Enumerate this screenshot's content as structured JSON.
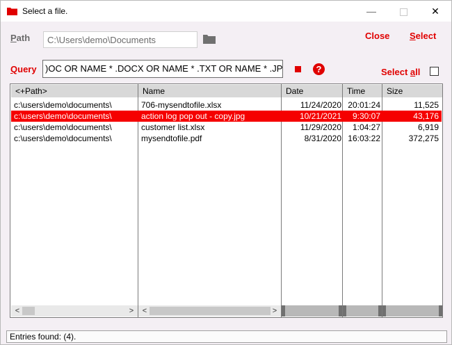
{
  "window": {
    "title": "Select a file.",
    "controls": {
      "minimize": "—",
      "close": "✕"
    }
  },
  "path": {
    "label_first": "P",
    "label_rest": "ath",
    "value": "C:\\Users\\demo\\Documents"
  },
  "actions": {
    "close": "Close",
    "select_first": "S",
    "select_rest": "elect"
  },
  "query": {
    "label_first": "Q",
    "label_rest": "uery",
    "value": ")OC OR NAME * .DOCX OR NAME * .TXT OR NAME * .JPG",
    "help": "?",
    "select_all_pre": "Select ",
    "select_all_u": "a",
    "select_all_post": "ll"
  },
  "table": {
    "columns": [
      "<+Path>",
      "Name",
      "Date",
      "Time",
      "Size"
    ],
    "rows": [
      {
        "path": "c:\\users\\demo\\documents\\",
        "name": "706-mysendtofile.xlsx",
        "date": "11/24/2020",
        "time": "20:01:24",
        "size": "11,525",
        "selected": false
      },
      {
        "path": "c:\\users\\demo\\documents\\",
        "name": "action log pop out - copy.jpg",
        "date": "10/21/2021",
        "time": "9:30:07",
        "size": "43,176",
        "selected": true
      },
      {
        "path": "c:\\users\\demo\\documents\\",
        "name": "customer list.xlsx",
        "date": "11/29/2020",
        "time": "1:04:27",
        "size": "6,919",
        "selected": false
      },
      {
        "path": "c:\\users\\demo\\documents\\",
        "name": "mysendtofile.pdf",
        "date": "8/31/2020",
        "time": "16:03:22",
        "size": "372,275",
        "selected": false
      }
    ]
  },
  "scroll": {
    "left": "<",
    "right": ">"
  },
  "status": {
    "text": "Entries found: (4)."
  },
  "colors": {
    "accent": "#e00000",
    "selection": "#f50000"
  }
}
